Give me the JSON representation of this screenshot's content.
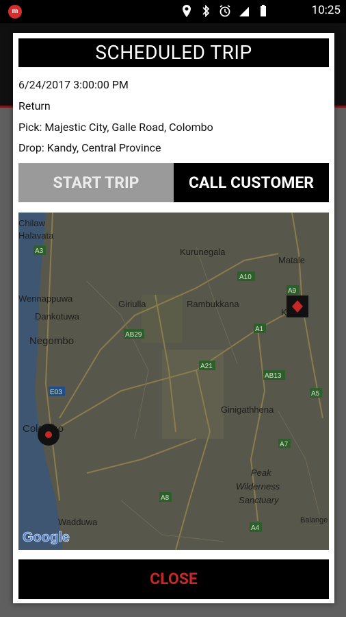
{
  "status_bar": {
    "app_icon": "my-app-icon",
    "icons": [
      "location-pin-icon",
      "bluetooth-icon",
      "alarm-icon",
      "signal-icon",
      "battery-icon"
    ],
    "time": "10:25"
  },
  "dialog": {
    "title": "SCHEDULED TRIP",
    "datetime": "6/24/2017 3:00:00 PM",
    "trip_type": "Return",
    "pick": "Pick: Majestic City, Galle Road, Colombo",
    "drop": "Drop: Kandy, Central Province",
    "start_button": "START TRIP",
    "call_button": "CALL CUSTOMER",
    "close_button": "CLOSE"
  },
  "map": {
    "places": [
      "Chilaw",
      "Halavata",
      "Kurunegala",
      "Matale",
      "Wennappuwa",
      "Dankotuwa",
      "Giriulla",
      "Rambukkana",
      "Kandy",
      "Negombo",
      "Ginigathhena",
      "Colombo",
      "Peak",
      "Wilderness",
      "Sanctuary",
      "Wadduwa",
      "Balange"
    ],
    "roads": [
      "A3",
      "A10",
      "A9",
      "AB29",
      "A1",
      "A21",
      "AB13",
      "E03",
      "A5",
      "A7",
      "A8",
      "A4"
    ],
    "attribution": "Google",
    "pickup_marker": "pickup-marker-icon",
    "dropoff_marker": "dropoff-marker-icon"
  }
}
